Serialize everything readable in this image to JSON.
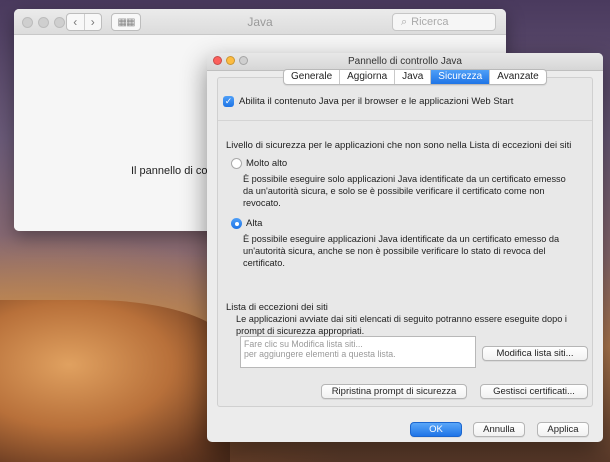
{
  "back_window": {
    "title": "Java",
    "search_placeholder": "Ricerca",
    "body_text": "Il pannello di contro"
  },
  "front_window": {
    "title": "Pannello di controllo Java",
    "tabs": [
      {
        "label": "Generale",
        "active": false
      },
      {
        "label": "Aggiorna",
        "active": false
      },
      {
        "label": "Java",
        "active": false
      },
      {
        "label": "Sicurezza",
        "active": true
      },
      {
        "label": "Avanzate",
        "active": false
      }
    ],
    "enable_checkbox": {
      "label": "Abilita il contenuto Java per il browser e le applicazioni Web Start",
      "checked": true
    },
    "security_level": {
      "heading": "Livello di sicurezza per le applicazioni che non sono nella Lista di eccezioni dei siti",
      "options": [
        {
          "label": "Molto alto",
          "selected": false,
          "description_lines": [
            "È possibile eseguire solo applicazioni Java identificate da un certificato emesso",
            "da un'autorità sicura, e solo se è possibile verificare il certificato come non",
            "revocato."
          ]
        },
        {
          "label": "Alta",
          "selected": true,
          "description_lines": [
            "È possibile eseguire applicazioni Java identificate da un certificato emesso da",
            "un'autorità sicura, anche se non è possibile verificare lo stato di revoca del",
            "certificato."
          ]
        }
      ]
    },
    "exceptions": {
      "heading": "Lista di eccezioni dei siti",
      "description_lines": [
        "Le applicazioni avviate dai siti elencati di seguito potranno essere eseguite dopo i",
        "prompt di sicurezza appropriati."
      ],
      "list_placeholder_lines": [
        "Fare clic su Modifica lista siti...",
        "per aggiungere elementi a questa lista."
      ],
      "edit_button": "Modifica lista siti..."
    },
    "restore_button": "Ripristina prompt di sicurezza",
    "certificates_button": "Gestisci certificati...",
    "ok_button": "OK",
    "cancel_button": "Annulla",
    "apply_button": "Applica"
  },
  "colors": {
    "accent": "#1e74e6",
    "traffic_red": "#fc605c",
    "traffic_yellow": "#fdbc40",
    "traffic_green": "#34c84a"
  }
}
